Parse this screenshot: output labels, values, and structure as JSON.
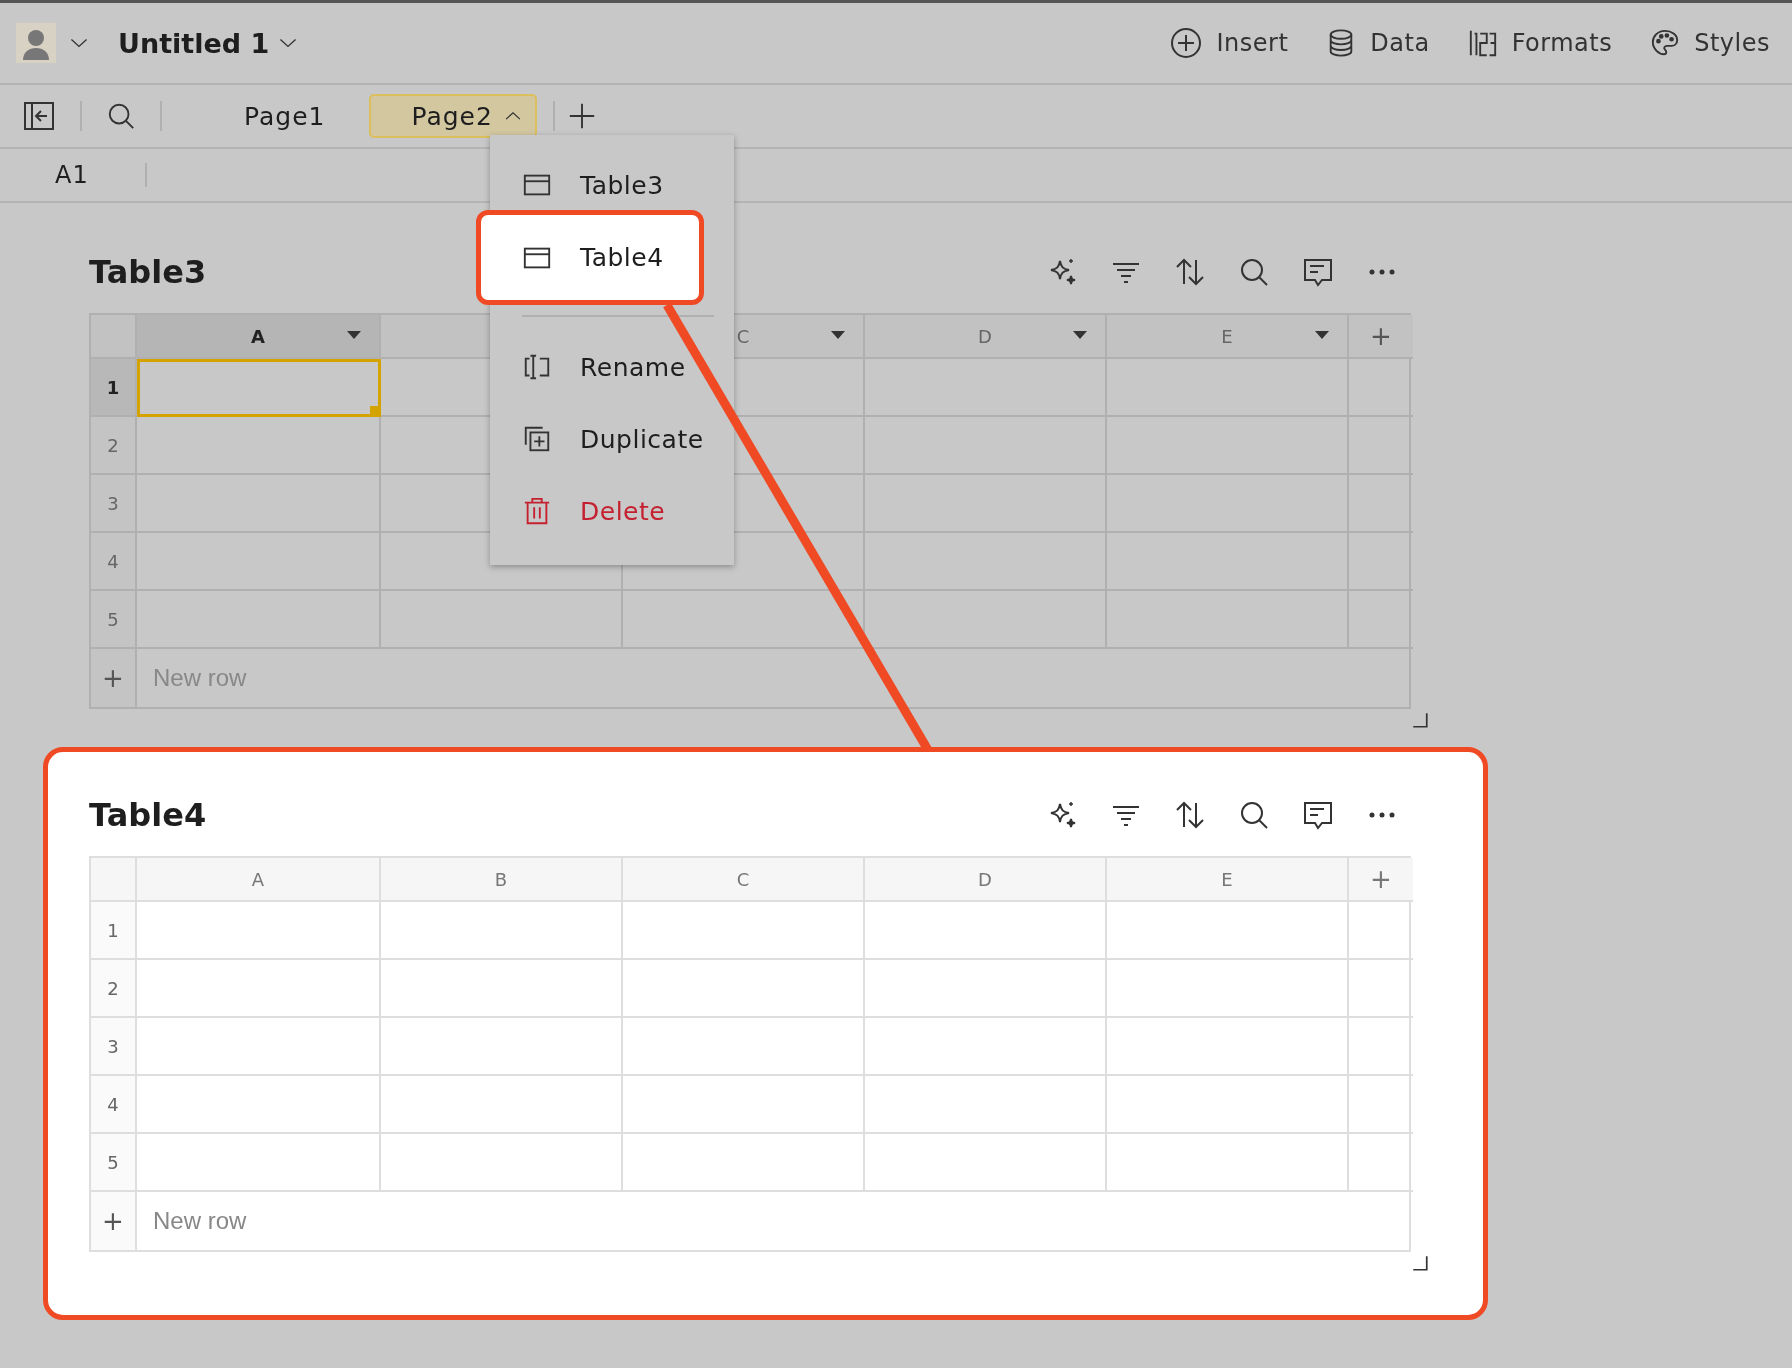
{
  "app_bar": {
    "document_title": "Untitled 1",
    "actions": [
      {
        "label": "Insert",
        "kind": "insert"
      },
      {
        "label": "Data",
        "kind": "data"
      },
      {
        "label": "Formats",
        "kind": "formats"
      },
      {
        "label": "Styles",
        "kind": "styles"
      }
    ]
  },
  "pages": [
    {
      "label": "Page1",
      "selected": false,
      "expanded": false
    },
    {
      "label": "Page2",
      "selected": true,
      "expanded": true
    }
  ],
  "cell_reference": "A1",
  "tables": [
    {
      "title": "Table3",
      "highlighted": false,
      "column_menus": true,
      "add_column": "+",
      "add_row": "+",
      "columns": [
        {
          "label": "A",
          "selected": true
        },
        {
          "selected": false
        },
        {
          "label": "C",
          "selected": false
        },
        {
          "label": "D",
          "selected": false
        },
        {
          "label": "E",
          "selected": false
        }
      ],
      "rows": [
        {
          "label": "1",
          "selected": true
        },
        {
          "label": "2",
          "selected": false
        },
        {
          "label": "3",
          "selected": false
        },
        {
          "label": "4",
          "selected": false
        },
        {
          "label": "5",
          "selected": false
        }
      ],
      "new_row": "New row"
    },
    {
      "title": "Table4",
      "highlighted": true,
      "column_menus": false,
      "add_column": "+",
      "add_row": "+",
      "columns": [
        {
          "label": "A",
          "selected": false
        },
        {
          "label": "B",
          "selected": false
        },
        {
          "label": "C",
          "selected": false
        },
        {
          "label": "D",
          "selected": false
        },
        {
          "label": "E",
          "selected": false
        }
      ],
      "rows": [
        {
          "label": "1",
          "selected": false
        },
        {
          "label": "2",
          "selected": false
        },
        {
          "label": "3",
          "selected": false
        },
        {
          "label": "4",
          "selected": false
        },
        {
          "label": "5",
          "selected": false
        }
      ],
      "new_row": "New row"
    }
  ],
  "table_menu": {
    "items": [
      {
        "label": "Table3",
        "kind": "table",
        "highlighted": false
      },
      {
        "label": "Table4",
        "kind": "table",
        "highlighted": true
      },
      {
        "kind": "separator"
      },
      {
        "label": "Rename",
        "kind": "rename",
        "highlighted": false
      },
      {
        "label": "Duplicate",
        "kind": "duplicate",
        "highlighted": false
      },
      {
        "label": "Delete",
        "kind": "delete",
        "highlighted": false
      }
    ]
  }
}
